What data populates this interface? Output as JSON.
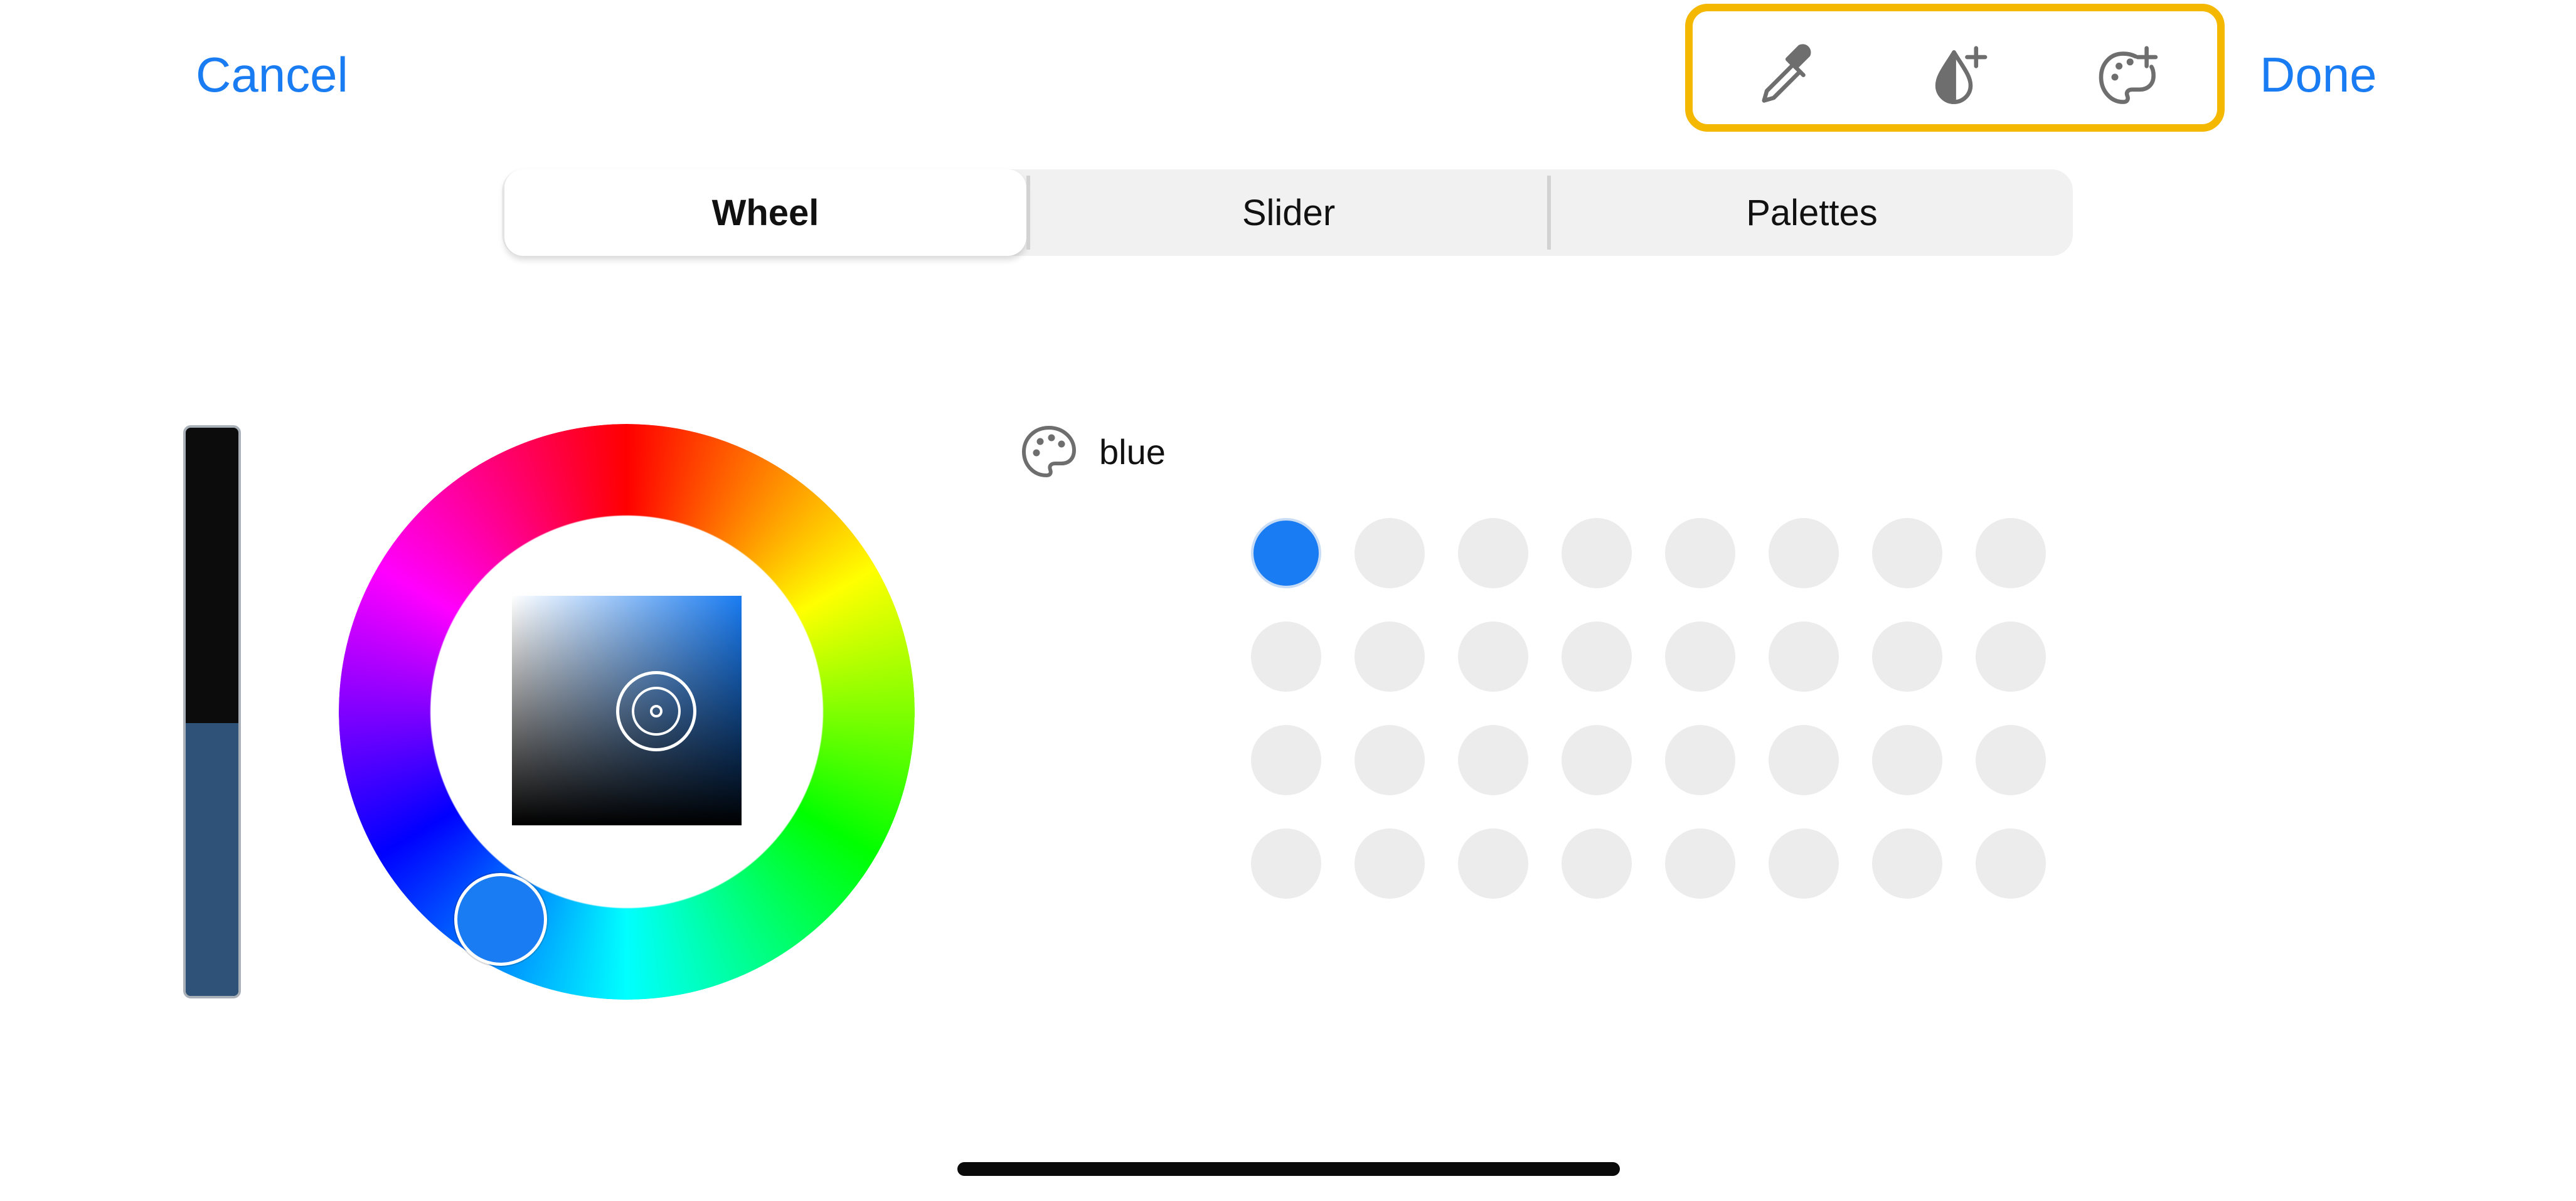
{
  "nav": {
    "cancel_label": "Cancel",
    "done_label": "Done"
  },
  "toolbar": {
    "highlight_color": "#f5b800",
    "icons": [
      "eyedropper-icon",
      "add-color-icon",
      "add-palette-icon"
    ]
  },
  "tabs": [
    {
      "label": "Wheel",
      "active": true
    },
    {
      "label": "Slider",
      "active": false
    },
    {
      "label": "Palettes",
      "active": false
    }
  ],
  "selected_color": "#1a7cf2",
  "brightness_fraction": 0.48,
  "palette": {
    "icon": "palette-icon",
    "name": "blue",
    "swatches": [
      "#1a7cf2",
      "",
      "",
      "",
      "",
      "",
      "",
      "",
      "",
      "",
      "",
      "",
      "",
      "",
      "",
      "",
      "",
      "",
      "",
      "",
      "",
      "",
      "",
      "",
      "",
      "",
      "",
      "",
      "",
      "",
      "",
      ""
    ]
  },
  "colors": {
    "accent": "#1a7cf2",
    "empty_swatch": "#ececec",
    "icon_gray": "#6e6e6e"
  }
}
